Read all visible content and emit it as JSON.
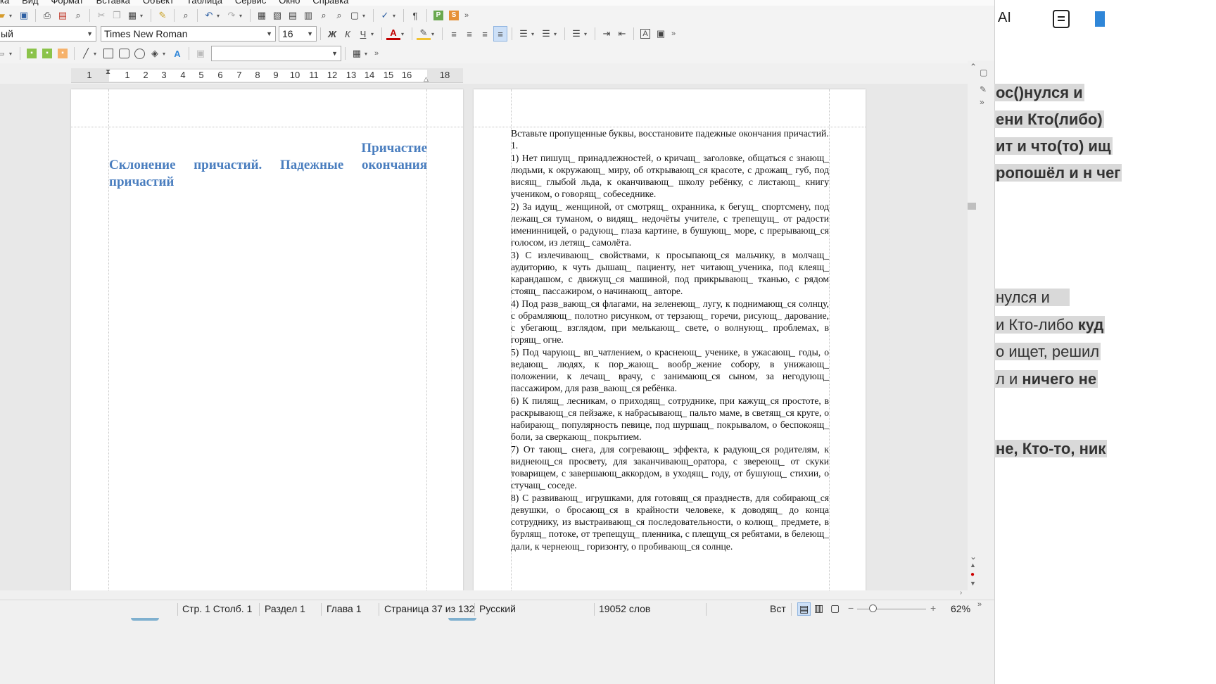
{
  "menu": [
    "ка",
    "Вид",
    "Формат",
    "Вставка",
    "Объект",
    "Таблица",
    "Сервис",
    "Окно",
    "Справка"
  ],
  "toolbar": {
    "paragraph_style": "ый",
    "font_name": "Times New Roman",
    "font_size": "16",
    "bold": "Ж",
    "italic": "К",
    "underline": "Ч",
    "font_color_letter": "A",
    "text_box_letter": "A",
    "pilcrow": "¶",
    "empty_combo": ""
  },
  "ruler": {
    "ticks": [
      "1",
      "1",
      "2",
      "3",
      "4",
      "5",
      "6",
      "7",
      "8",
      "9",
      "10",
      "11",
      "12",
      "13",
      "14",
      "15",
      "16",
      "18"
    ]
  },
  "document": {
    "heading_right": "Причастие",
    "heading_line2": "Склонение причастий. Падежные окончания",
    "heading_line3": "причастий",
    "paragraphs": [
      "Вставьте пропущенные буквы, восстановите падежные окончания причастий.",
      "1.",
      "1) Нет пишущ_ принадлежностей, о кричащ_ заголовке, общаться с знающ_ людьми, к окружающ_ миру, об открывающ_ся красоте, с дрожащ_ губ, под висящ_ глыбой льда, к оканчивающ_ школу ребёнку, с листающ_ книгу учеником, о говорящ_ собеседнике.",
      "2) За идущ_ женщиной, от смотрящ_ охранника, к бегущ_ спортсмену, под лежащ_ся туманом, о видящ_ недочёты учителе, с трепещущ_ от радости именинницей, о радующ_ глаза картине, в бушующ_ море, с прерывающ_ся голосом, из летящ_ самолёта.",
      "3) С излечивающ_ свойствами, к просыпающ_ся мальчику, в молчащ_ аудиторию, к чуть дышащ_ пациенту, нет читающ_ученика, под клеящ_ карандашом, с движущ_ся машиной, под прикрывающ_ тканью, с рядом стоящ_ пассажиром, о начинающ_ авторе.",
      "4) Под разв_вающ_ся флагами, на зеленеющ_ лугу, к поднимающ_ся солнцу, с обрамляющ_ полотно рисунком, от терзающ_ горечи, рисующ_ дарование, с убегающ_ взглядом, при мелькающ_ свете, о волнующ_ проблемах, в горящ_ огне.",
      "5) Под чарующ_ вп_чатлением, о краснеющ_ ученике, в ужасающ_ годы, о ведающ_ людях, к пор_жающ_ вообр_жение собору, в унижающ_ положении, к лечащ_ врачу, с занимающ_ся сыном, за негодующ_ пассажиром, для разв_вающ_ся ребёнка.",
      "6) К пилящ_ лесникам, о приходящ_ сотруднике, при кажущ_ся простоте, в раскрывающ_ся пейзаже, к набрасывающ_ пальто маме, в светящ_ся круге, о набирающ_ популярность певице, под шуршащ_ покрывалом, о беспокоящ_ боли, за сверкающ_ покрытием.",
      "7) От тающ_ снега, для согревающ_ эффекта, к радующ_ся родителям, к виднеющ_ся просвету, для заканчивающ_оратора, с звереющ_ от скуки товарищем, с завершающ_аккордом, в уходящ_ году, от бушующ_ стихии, о стучащ_ соседе.",
      "8) С развивающ_ игрушками, для готовящ_ся празднеств, для собирающ_ся девушки, о бросающ_ся в крайности человеке, к доводящ_ до конца сотруднику, из выстраивающ_ся последовательности, о колющ_ предмете, в бурлящ_ потоке, от трепещущ_ пленника, с плещущ_ся ребятами, в белеющ_ дали, к чернеющ_ горизонту, о пробивающ_ся солнце."
    ]
  },
  "statusbar": {
    "page_col": "Стр. 1 Столб. 1",
    "section": "Раздел 1",
    "chapter": "Глава 1",
    "page_of": "Страница 37 из 132",
    "language": "Русский",
    "word_count": "19052 слов",
    "insert_mode": "Вст",
    "zoom": "62%"
  },
  "side_panel": {
    "ai_label": "AI",
    "lines": {
      "l1": "ос()нулся и",
      "l2": "ени Кто(либо)",
      "l3": "ит и что(то) ищ",
      "l4": "ропошёл и н чег",
      "l5": "нулся и",
      "l6a": "и Кто-либо ",
      "l6b": "куд",
      "l7": "о ищет, решил",
      "l8a": "л и ",
      "l8b": "ничего не",
      "l9": "не, Кто-то, ник"
    }
  },
  "colors": {
    "heading": "#4a7ebf",
    "highlight": "#d9d9d9",
    "accent_blue": "#2f86d8"
  }
}
